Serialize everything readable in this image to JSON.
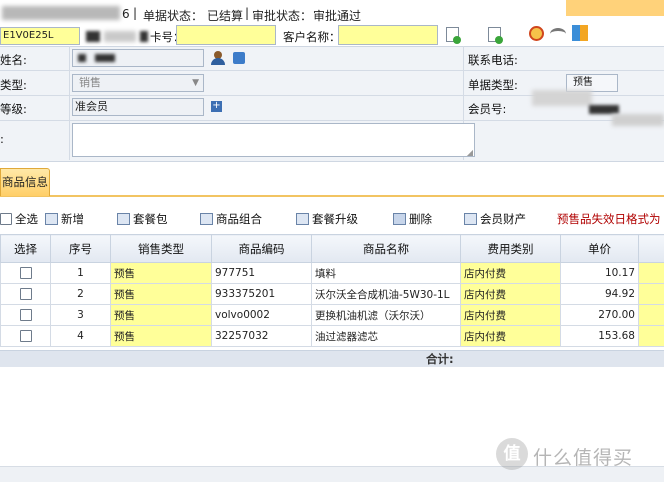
{
  "status_bar": {
    "bill_no": "E1V0E25L",
    "tail_digit": "6",
    "separator": "|",
    "bill_status_label": "单据状态：",
    "bill_status_value": "已结算",
    "approval_status_label": "审批状态：",
    "approval_status_value": "审批通过",
    "card_no_label": "卡号：",
    "customer_name_label": "客户名称："
  },
  "form": {
    "name_label": "姓名:",
    "type_label": "类型:",
    "sales_type_value": "销售",
    "level_label": "等级:",
    "member_level_value": "准会员",
    "remark_label": ":",
    "phone_label": "联系电话:",
    "bill_type_label": "单据类型:",
    "bill_type_value": "预售",
    "member_no_label": "会员号:"
  },
  "tab": {
    "label": "商品信息"
  },
  "toolbar": {
    "select_all": "全选",
    "add": "新增",
    "package": "套餐包",
    "combo": "商品组合",
    "package_upgrade": "套餐升级",
    "delete": "删除",
    "member_assets": "会员财产",
    "warning": "预售品失效日格式为"
  },
  "table": {
    "columns": [
      "选择",
      "序号",
      "销售类型",
      "商品编码",
      "商品名称",
      "费用类别",
      "单价"
    ],
    "rows": [
      {
        "seq": "1",
        "sale_type": "预售",
        "code": "977751",
        "name": "填料",
        "fee": "店内付费",
        "price": "10.17"
      },
      {
        "seq": "2",
        "sale_type": "预售",
        "code": "933375201",
        "name": "沃尔沃全合成机油-5W30-1L",
        "fee": "店内付费",
        "price": "94.92"
      },
      {
        "seq": "3",
        "sale_type": "预售",
        "code": "volvo0002",
        "name": "更换机油机滤（沃尔沃）",
        "fee": "店内付费",
        "price": "270.00"
      },
      {
        "seq": "4",
        "sale_type": "预售",
        "code": "32257032",
        "name": "油过滤器滤芯",
        "fee": "店内付费",
        "price": "153.68"
      }
    ],
    "total_label": "合计:"
  },
  "watermark": {
    "text": "什么值得买",
    "logo_char": "值"
  },
  "colors": {
    "field_yellow": "#ffff99",
    "header_blue": "#e2e8f1",
    "warning_red": "#b00000",
    "tab_orange": "#ffd27a"
  }
}
